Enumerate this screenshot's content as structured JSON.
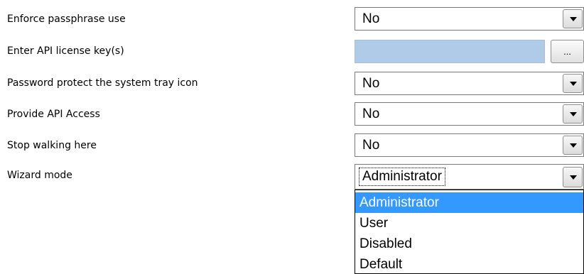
{
  "settings": {
    "enforce_passphrase": {
      "label": "Enforce passphrase use",
      "value": "No"
    },
    "api_license": {
      "label": "Enter API license key(s)",
      "value": "",
      "button": "..."
    },
    "password_tray": {
      "label": "Password protect the system tray icon",
      "value": "No"
    },
    "api_access": {
      "label": "Provide API Access",
      "value": "No"
    },
    "stop_walking": {
      "label": "Stop walking here",
      "value": "No"
    },
    "wizard_mode": {
      "label": "Wizard mode",
      "value": "Administrator",
      "options": [
        "Administrator",
        "User",
        "Disabled",
        "Default"
      ],
      "highlighted_option": "Administrator"
    }
  },
  "colors": {
    "selection_highlight": "#3399ff",
    "license_field_fill": "#b0cbe8"
  },
  "icons": {
    "dropdown_arrow": "chevron-down-icon"
  }
}
